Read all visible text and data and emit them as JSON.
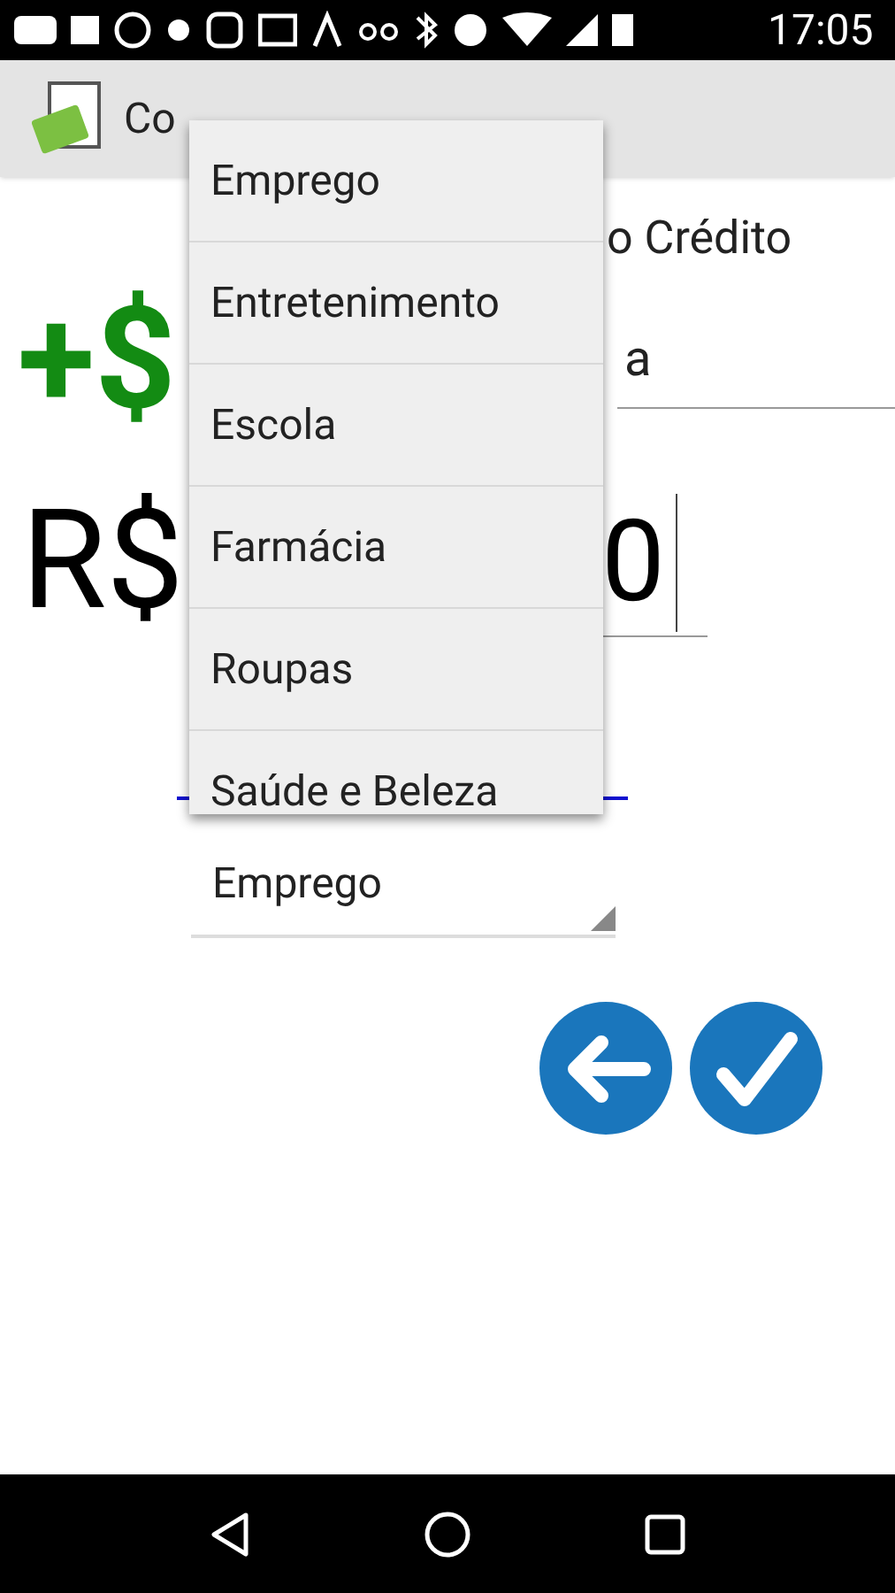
{
  "status_bar": {
    "time": "17:05"
  },
  "app_bar": {
    "title": "Co"
  },
  "form": {
    "badge": "+$",
    "type_label": "o Crédito",
    "description_value": "a",
    "amount_currency": "R$",
    "amount_value": "0",
    "category_value": "Emprego"
  },
  "dropdown": {
    "items": [
      {
        "label": "Emprego"
      },
      {
        "label": "Entretenimento"
      },
      {
        "label": "Escola"
      },
      {
        "label": "Farmácia"
      },
      {
        "label": "Roupas"
      },
      {
        "label": "Saúde e Beleza"
      }
    ]
  }
}
